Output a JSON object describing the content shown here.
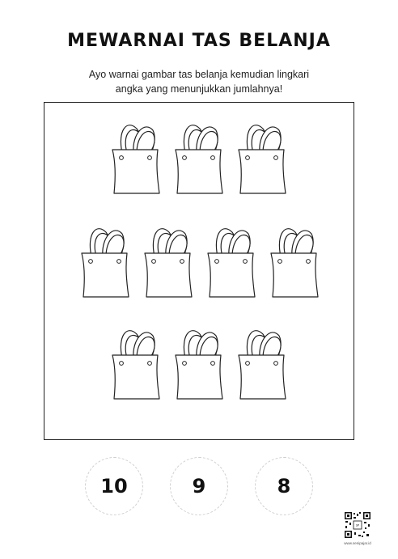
{
  "worksheet": {
    "title": "MEWARNAI TAS BELANJA",
    "instruction_line1": "Ayo warnai gambar tas belanja kemudian lingkari",
    "instruction_line2": "angka yang menunjukkan jumlahnya!"
  },
  "picture": {
    "item_icon": "shopping-bag-icon",
    "bag_count": 10,
    "rows": [
      3,
      4,
      3
    ]
  },
  "answers": [
    {
      "label": "10"
    },
    {
      "label": "9"
    },
    {
      "label": "8"
    }
  ],
  "footer": {
    "qr_icon": "qr-code-icon",
    "site": "www.senipajar.id"
  }
}
